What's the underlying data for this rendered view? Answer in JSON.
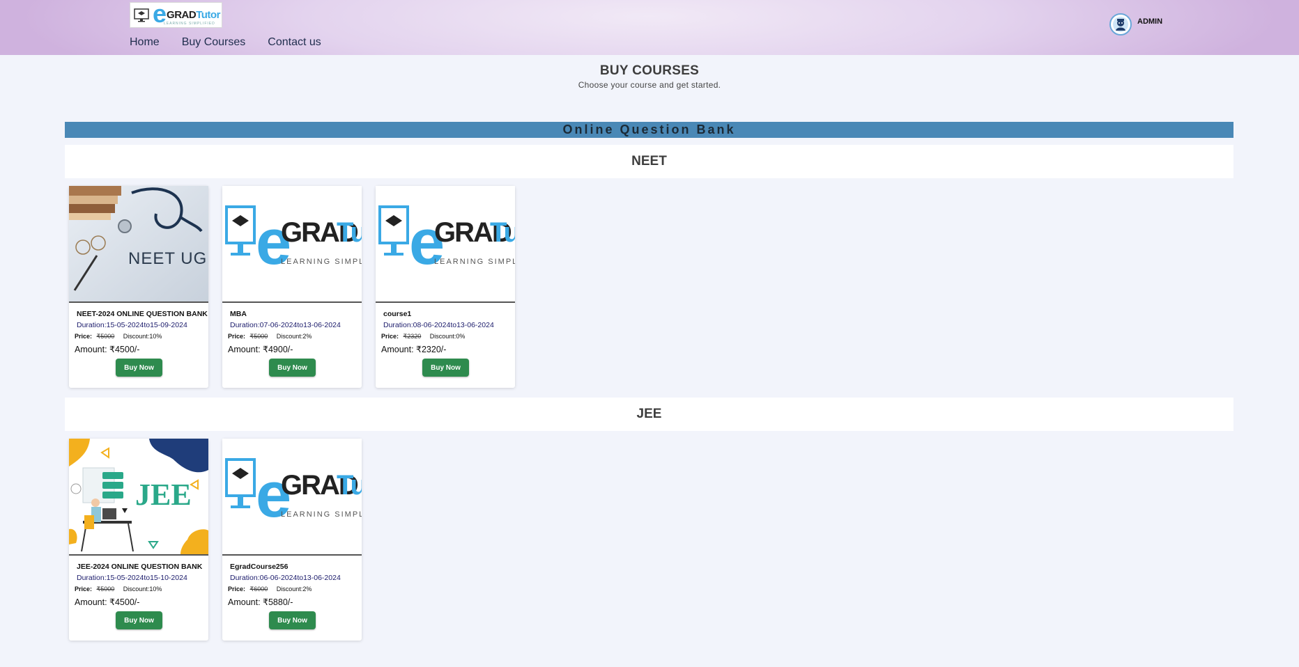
{
  "header": {
    "logo": {
      "e": "e",
      "grad": "GRAD",
      "tutor": "Tutor",
      "tagline": "LEARNING SIMPLIFIED"
    },
    "nav": [
      "Home",
      "Buy Courses",
      "Contact us"
    ],
    "user": {
      "name": "ADMIN"
    }
  },
  "page": {
    "title": "BUY COURSES",
    "subtitle": "Choose your course and get started."
  },
  "section": {
    "title": "Online Question Bank"
  },
  "categories": [
    {
      "name": "NEET",
      "courses": [
        {
          "name": "NEET-2024 ONLINE QUESTION BANK",
          "duration": "Duration:15-05-2024to15-09-2024",
          "price_label": "Price:",
          "old_price": "₹5000",
          "discount": "Discount:10%",
          "amount": "Amount: ₹4500/-",
          "button": "Buy Now",
          "image": "neet-ug",
          "image_text": "NEET UG"
        },
        {
          "name": "MBA",
          "duration": "Duration:07-06-2024to13-06-2024",
          "price_label": "Price:",
          "old_price": "₹5000",
          "discount": "Discount:2%",
          "amount": "Amount: ₹4900/-",
          "button": "Buy Now",
          "image": "egrad-logo"
        },
        {
          "name": "course1",
          "duration": "Duration:08-06-2024to13-06-2024",
          "price_label": "Price:",
          "old_price": "₹2320",
          "discount": "Discount:0%",
          "amount": "Amount: ₹2320/-",
          "button": "Buy Now",
          "image": "egrad-logo"
        }
      ]
    },
    {
      "name": "JEE",
      "courses": [
        {
          "name": "JEE-2024 ONLINE QUESTION BANK",
          "duration": "Duration:15-05-2024to15-10-2024",
          "price_label": "Price:",
          "old_price": "₹5000",
          "discount": "Discount:10%",
          "amount": "Amount: ₹4500/-",
          "button": "Buy Now",
          "image": "jee",
          "image_text": "JEE"
        },
        {
          "name": "EgradCourse256",
          "duration": "Duration:06-06-2024to13-06-2024",
          "price_label": "Price:",
          "old_price": "₹6000",
          "discount": "Discount:2%",
          "amount": "Amount: ₹5880/-",
          "button": "Buy Now",
          "image": "egrad-logo"
        }
      ]
    }
  ],
  "colors": {
    "bank_bar": "#4a88b6",
    "buy_button": "#2e8b4e",
    "brand_blue": "#3aa9e5"
  }
}
